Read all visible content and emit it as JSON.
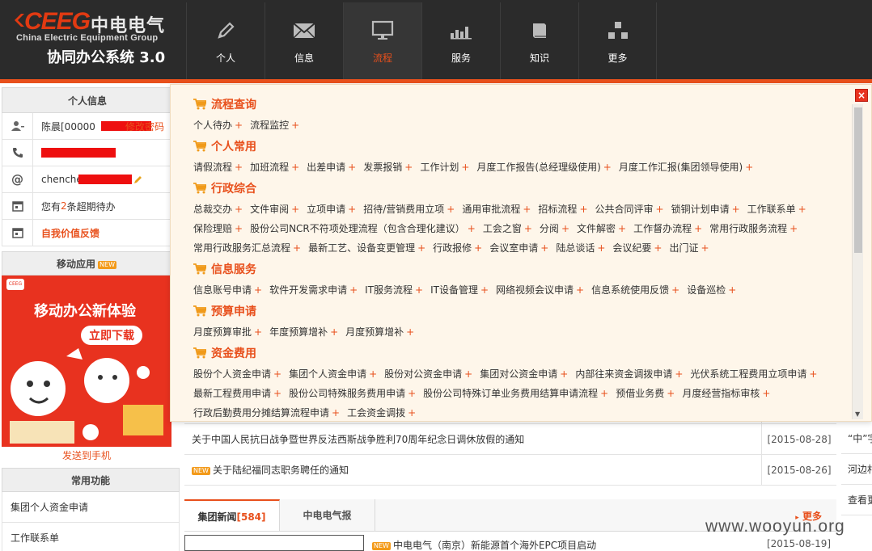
{
  "header": {
    "logo_ceeg": "CEEG",
    "logo_cn": "中电电气",
    "logo_en": "China Electric Equipment Group",
    "system_title": "协同办公系统 3.0",
    "nav": [
      {
        "label": "个人",
        "icon": "pencil-icon"
      },
      {
        "label": "信息",
        "icon": "envelope-icon"
      },
      {
        "label": "流程",
        "icon": "monitor-icon",
        "active": true
      },
      {
        "label": "服务",
        "icon": "bar-chart-icon"
      },
      {
        "label": "知识",
        "icon": "book-icon"
      },
      {
        "label": "更多",
        "icon": "blocks-icon"
      }
    ]
  },
  "personal": {
    "title": "个人信息",
    "name_prefix": "陈晨[00000",
    "change_password": "修改密码",
    "email_prefix": "chenche",
    "overdue_pre": "您有",
    "overdue_count": "2",
    "overdue_post": "条超期待办",
    "feedback": "自我价值反馈"
  },
  "mobile": {
    "title": "移动应用",
    "badge": "NEW",
    "promo_line1": "移动办公新体验",
    "promo_line2": "立即下载",
    "promo_logo": "CEEG",
    "send_to_phone": "发送到手机"
  },
  "common": {
    "title": "常用功能",
    "items": [
      "集团个人资金申请",
      "工作联系单"
    ]
  },
  "news": {
    "rows": [
      {
        "title": "关于中国人民抗日战争暨世界反法西斯战争胜利70周年纪念日调休放假的通知",
        "date": "[2015-08-28]",
        "new": false
      },
      {
        "title": "关于陆纪福同志职务聘任的通知",
        "date": "[2015-08-26]",
        "new": true
      }
    ],
    "tabs": [
      {
        "label": "集团新闻",
        "count": "[584]"
      },
      {
        "label": "中电电气报",
        "count": ""
      }
    ],
    "more": "更多",
    "bottom_title": "中电电气（南京）新能源首个海外EPC项目启动",
    "bottom_date": "[2015-08-19]",
    "new_badge": "NEW"
  },
  "right_col": [
    "“中”字",
    "河边村",
    "查看更"
  ],
  "watermark": "www.wooyun.org",
  "dropdown": {
    "close": "×",
    "categories": [
      {
        "title": "流程查询",
        "items": [
          "个人待办",
          "流程监控"
        ]
      },
      {
        "title": "个人常用",
        "items": [
          "请假流程",
          "加班流程",
          "出差申请",
          "发票报销",
          "工作计划",
          "月度工作报告(总经理级使用)",
          "月度工作汇报(集团领导使用)"
        ]
      },
      {
        "title": "行政综合",
        "items": [
          "总裁交办",
          "文件审阅",
          "立项申请",
          "招待/营销费用立项",
          "通用审批流程",
          "招标流程",
          "公共合同评审",
          "锁铜计划申请",
          "工作联系单",
          "保险理赔",
          "股份公司NCR不符项处理流程（包含合理化建议）",
          "工会之窗",
          "分阅",
          "文件解密",
          "工作督办流程",
          "常用行政服务流程",
          "常用行政服务汇总流程",
          "最新工艺、设备变更管理",
          "行政报修",
          "会议室申请",
          "陆总谈话",
          "会议纪要",
          "出门证"
        ]
      },
      {
        "title": "信息服务",
        "items": [
          "信息账号申请",
          "软件开发需求申请",
          "IT服务流程",
          "IT设备管理",
          "网络视频会议申请",
          "信息系统使用反馈",
          "设备巡检"
        ]
      },
      {
        "title": "预算申请",
        "items": [
          "月度预算审批",
          "年度预算增补",
          "月度预算增补"
        ]
      },
      {
        "title": "资金费用",
        "items": [
          "股份个人资金申请",
          "集团个人资金申请",
          "股份对公资金申请",
          "集团对公资金申请",
          "内部往来资金调拨申请",
          "光伏系统工程费用立项申请",
          "最新工程费用申请",
          "股份公司特殊服务费用申请",
          "股份公司特殊订单业务费用结算申请流程",
          "预借业务费",
          "月度经营指标审核",
          "行政后勤费用分摊结算流程申请",
          "工会资金调拨"
        ]
      }
    ]
  }
}
